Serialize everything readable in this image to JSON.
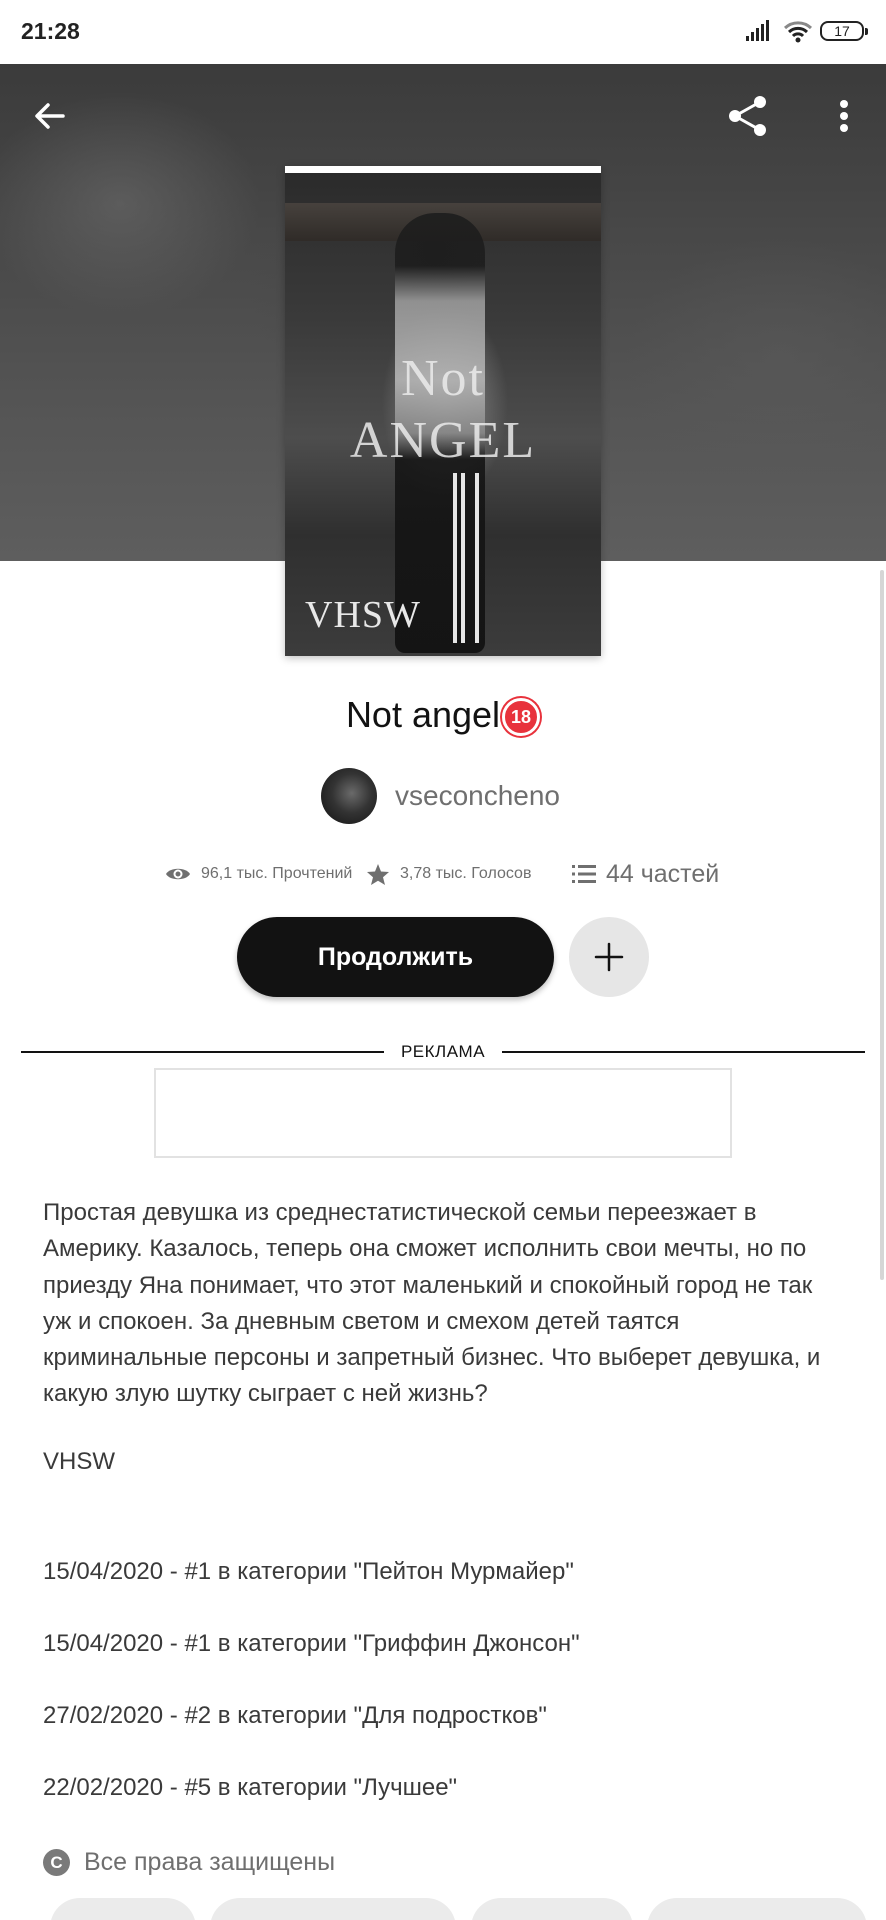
{
  "status_bar": {
    "time": "21:28",
    "battery": "17"
  },
  "header": {
    "back_icon": "arrow-left-icon",
    "share_icon": "share-icon",
    "more_icon": "more-vertical-icon"
  },
  "cover": {
    "title_line1": "Not",
    "title_line2": "angel",
    "author_mark": "VHSW"
  },
  "book": {
    "title": "Not angel",
    "badge": "18",
    "author": "vseconcheno"
  },
  "stats": {
    "reads": "96,1 тыс. Прочтений",
    "votes": "3,78 тыс. Голосов",
    "parts": "44 частей"
  },
  "actions": {
    "continue_label": "Продолжить",
    "add_icon": "plus-icon"
  },
  "ad": {
    "label": "РЕКЛАМА"
  },
  "description": {
    "text": "Простая девушка из среднестатистической семьи переезжает в Америку. Казалось, теперь она сможет исполнить свои мечты, но по приезду Яна понимает, что этот маленький и спокойный город не так уж и спокоен. За дневным светом и смехом детей таятся криминальные персоны и запретный бизнес. Что выберет девушка, и какую злую шутку сыграет с ней жизнь?",
    "signature": "VHSW",
    "rankings": [
      "15/04/2020 - #1 в категории \"Пейтон Мурмайер\"",
      "15/04/2020 - #1 в категории \"Гриффин Джонсон\"",
      "27/02/2020 - #2 в категории \"Для подростков\"",
      "22/02/2020 - #5 в категории \"Лучшее\""
    ]
  },
  "rights": {
    "icon": "C",
    "label": "Все права защищены"
  },
  "colors": {
    "primary": "#121212",
    "muted": "#6f6f6f",
    "badge": "#e8323c",
    "chip": "#ebebeb"
  }
}
